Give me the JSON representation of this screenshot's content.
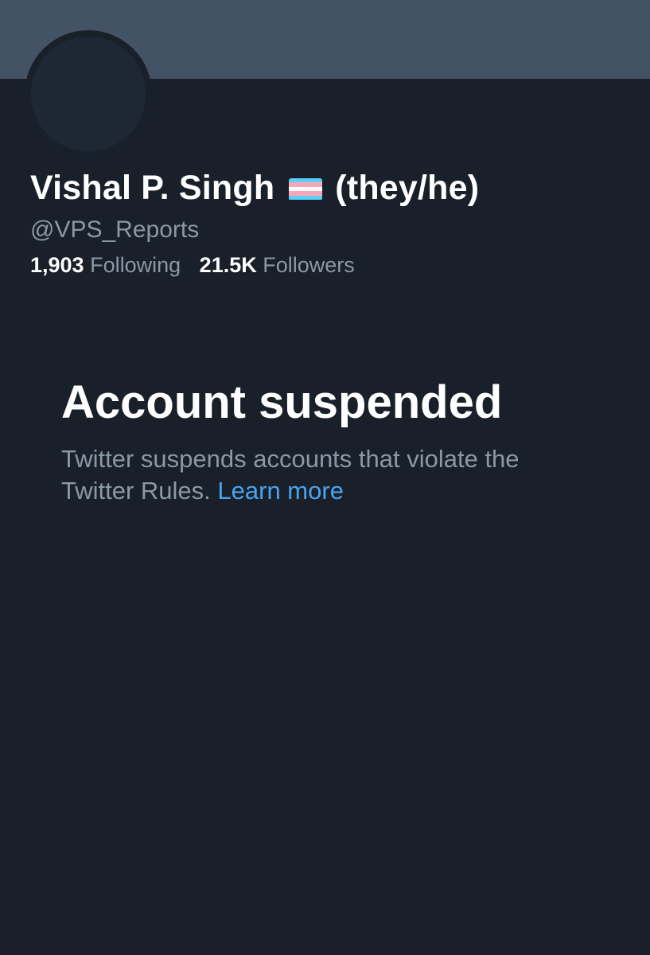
{
  "profile": {
    "display_name": "Vishal P. Singh",
    "flag_icon": "transgender-flag-icon",
    "pronouns": "(they/he)",
    "handle": "@VPS_Reports",
    "following_count": "1,903",
    "following_label": "Following",
    "followers_count": "21.5K",
    "followers_label": "Followers"
  },
  "suspension": {
    "title": "Account suspended",
    "message_line1": "Twitter suspends accounts that violate the",
    "message_line2": "Twitter Rules.",
    "learn_more": "Learn more"
  },
  "colors": {
    "background": "#19202a",
    "banner": "#445266",
    "primary_text": "#ffffff",
    "secondary_text": "#8b98a5",
    "link": "#4aa3ef",
    "flag_blue": "#5bcefa",
    "flag_pink": "#f5a9b8",
    "flag_white": "#ffffff"
  }
}
